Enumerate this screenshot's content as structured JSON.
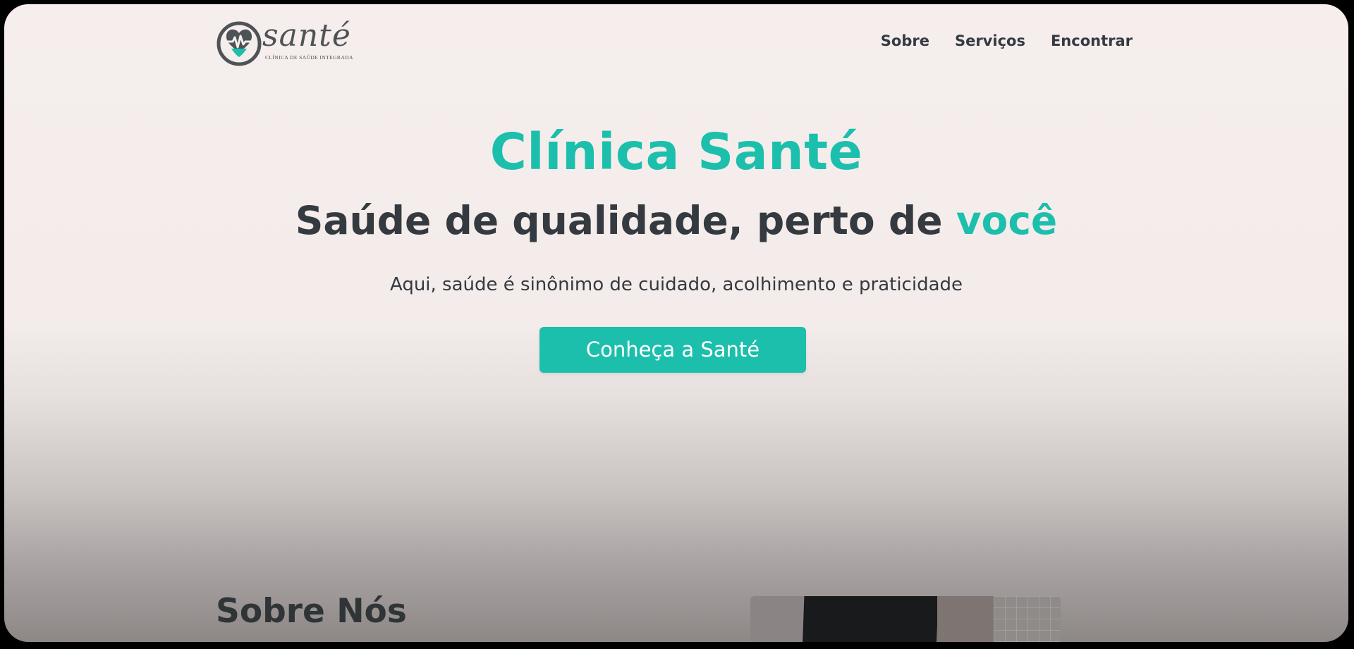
{
  "header": {
    "logo": {
      "wordmark": "santé",
      "tagline": "CLÍNICA DE SAÚDE INTEGRADA"
    },
    "nav": [
      {
        "label": "Sobre"
      },
      {
        "label": "Serviços"
      },
      {
        "label": "Encontrar"
      }
    ]
  },
  "hero": {
    "title": "Clínica Santé",
    "subtitle_main": "Saúde de qualidade, perto de ",
    "subtitle_accent": "você",
    "description": "Aqui, saúde é sinônimo de cuidado, acolhimento e praticidade",
    "cta_label": "Conheça a Santé"
  },
  "about": {
    "heading": "Sobre Nós"
  },
  "colors": {
    "accent": "#1cbfac",
    "text_dark": "#343a40",
    "background": "#f5eeec"
  }
}
